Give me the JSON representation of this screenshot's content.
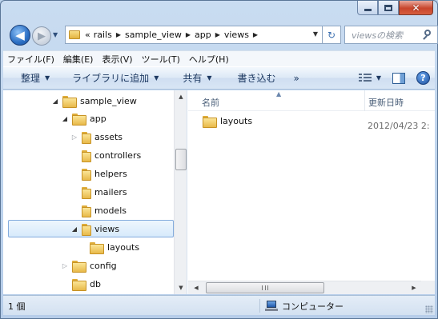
{
  "window": {
    "caption_buttons": {
      "minimize": "minimize-icon",
      "maximize": "maximize-icon",
      "close": "close-icon"
    }
  },
  "nav": {
    "back_glyph": "◀",
    "forward_glyph": "▶",
    "breadcrumb_prefix": "«",
    "breadcrumbs": [
      "rails",
      "sample_view",
      "app",
      "views"
    ],
    "search_placeholder": "viewsの検索",
    "refresh_glyph": "↻"
  },
  "menu": [
    "ファイル(F)",
    "編集(E)",
    "表示(V)",
    "ツール(T)",
    "ヘルプ(H)"
  ],
  "commands": {
    "organize": "整理",
    "library": "ライブラリに追加",
    "share": "共有",
    "burn": "書き込む",
    "more": "»"
  },
  "tree": {
    "items": [
      {
        "label": "sample_view",
        "expander": "open"
      },
      {
        "label": "app",
        "expander": "open"
      },
      {
        "label": "assets",
        "expander": "collapsed"
      },
      {
        "label": "controllers",
        "expander": "none"
      },
      {
        "label": "helpers",
        "expander": "none"
      },
      {
        "label": "mailers",
        "expander": "none"
      },
      {
        "label": "models",
        "expander": "none"
      },
      {
        "label": "views",
        "expander": "open",
        "selected": true
      },
      {
        "label": "layouts",
        "expander": "none"
      },
      {
        "label": "config",
        "expander": "collapsed"
      },
      {
        "label": "db",
        "expander": "none"
      }
    ],
    "expander_open_glyph": "◢",
    "expander_collapsed_glyph": "▷"
  },
  "files": {
    "columns": {
      "name": "名前",
      "date": "更新日時"
    },
    "rows": [
      {
        "name": "layouts",
        "date": "2012/04/23 2:"
      }
    ]
  },
  "status": {
    "count": "1 個",
    "zone": "コンピューター"
  }
}
